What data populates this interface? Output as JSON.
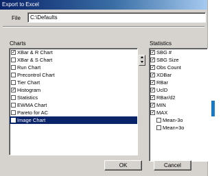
{
  "window": {
    "title": "Export to Excel"
  },
  "file": {
    "label": "File",
    "value": "C:\\Defaults"
  },
  "charts": {
    "label": "Charts",
    "items": [
      {
        "label": "XBar & R Chart",
        "checked": true,
        "selected": false
      },
      {
        "label": "XBar & S Chart",
        "checked": false,
        "selected": false
      },
      {
        "label": "Run Chart",
        "checked": false,
        "selected": false
      },
      {
        "label": "Precontrol Chart",
        "checked": false,
        "selected": false
      },
      {
        "label": "Tier Chart",
        "checked": false,
        "selected": false
      },
      {
        "label": "Histogram",
        "checked": true,
        "selected": false
      },
      {
        "label": "Statistics",
        "checked": false,
        "selected": false
      },
      {
        "label": "EWMA Chart",
        "checked": false,
        "selected": false
      },
      {
        "label": "Pareto for AC",
        "checked": false,
        "selected": false
      },
      {
        "label": "Image Chart",
        "checked": false,
        "selected": true
      }
    ]
  },
  "statistics": {
    "label": "Statistics",
    "items": [
      {
        "label": "SBG #",
        "checked": true,
        "indent": false
      },
      {
        "label": "SBG Size",
        "checked": true,
        "indent": false
      },
      {
        "label": "Obs Count",
        "checked": true,
        "indent": false
      },
      {
        "label": "XDBar",
        "checked": true,
        "indent": false
      },
      {
        "label": "RBar",
        "checked": true,
        "indent": false
      },
      {
        "label": "UclD",
        "checked": true,
        "indent": false
      },
      {
        "label": "RBar/d2",
        "checked": true,
        "indent": false
      },
      {
        "label": "MIN",
        "checked": true,
        "indent": false
      },
      {
        "label": "MAX",
        "checked": true,
        "indent": false
      },
      {
        "label": "Mean-3o",
        "checked": false,
        "indent": true
      },
      {
        "label": "Mean+3o",
        "checked": false,
        "indent": true
      }
    ]
  },
  "buttons": {
    "ok": "OK",
    "cancel": "Cancel"
  },
  "colors": {
    "titlebar": "#0a246a",
    "selection": "#0a246a",
    "dialog": "#d6d3ce",
    "marker": "#1a79c4"
  },
  "icons": {
    "scroll_up": "triangle-up",
    "scroll_down": "triangle-down",
    "check": "check-mark"
  }
}
